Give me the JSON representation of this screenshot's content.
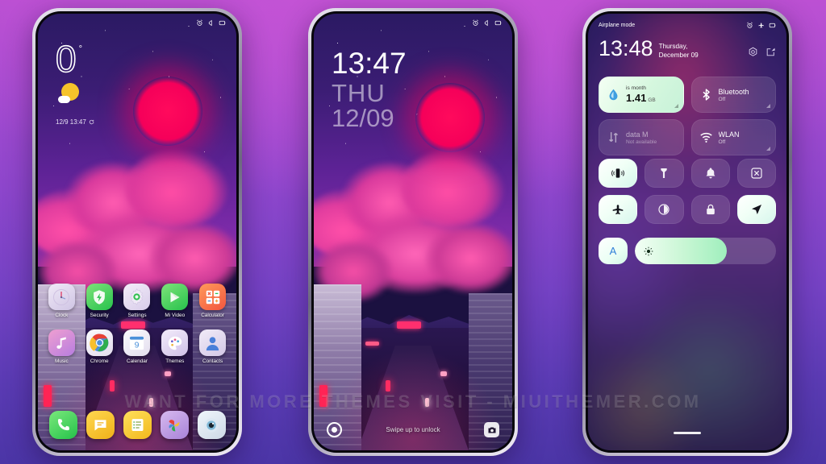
{
  "watermark": "WANT FOR MORE THEMES VISIT  -  MIUITHEMER.COM",
  "phone1": {
    "name": "home-screen",
    "status_bar": {
      "icons": [
        "alarm-icon",
        "silent-icon",
        "battery-icon"
      ]
    },
    "weather_widget": {
      "temperature": "0",
      "degree": "°",
      "icon": "sun-behind-cloud-icon",
      "updated": "12/9 13:47",
      "refresh_icon": "refresh-icon"
    },
    "apps_row1": [
      {
        "label": "Clock",
        "icon": "clock-icon"
      },
      {
        "label": "Security",
        "icon": "shield-icon"
      },
      {
        "label": "Settings",
        "icon": "gear-icon"
      },
      {
        "label": "Mi Video",
        "icon": "play-icon"
      },
      {
        "label": "Calculator",
        "icon": "calculator-icon"
      }
    ],
    "apps_row2": [
      {
        "label": "Music",
        "icon": "music-note-icon"
      },
      {
        "label": "Chrome",
        "icon": "chrome-icon"
      },
      {
        "label": "Calendar",
        "icon": "calendar-icon",
        "day": "9"
      },
      {
        "label": "Themes",
        "icon": "palette-icon"
      },
      {
        "label": "Contacts",
        "icon": "person-icon"
      }
    ],
    "dock": [
      {
        "label": "Phone",
        "icon": "phone-icon"
      },
      {
        "label": "Messages",
        "icon": "message-icon"
      },
      {
        "label": "Notes",
        "icon": "notes-icon"
      },
      {
        "label": "Gallery",
        "icon": "gallery-icon"
      },
      {
        "label": "Camera",
        "icon": "camera-icon"
      }
    ]
  },
  "phone2": {
    "name": "lock-screen",
    "status_bar": {
      "icons": [
        "alarm-icon",
        "silent-icon",
        "battery-icon"
      ]
    },
    "clock": {
      "time": "13:47",
      "weekday": "THU",
      "date": "12/09"
    },
    "bottom": {
      "left_icon": "flashlight-icon",
      "hint": "Swipe up to unlock",
      "right_icon": "camera-icon"
    }
  },
  "phone3": {
    "name": "control-center",
    "status_bar": {
      "carrier": "Airplane mode",
      "icons": [
        "alarm-icon",
        "airplane-icon",
        "battery-icon"
      ]
    },
    "header": {
      "time": "13:48",
      "date": "Thursday, December 09",
      "icons": [
        "settings-hex-icon",
        "edit-icon"
      ]
    },
    "tiles_row1": [
      {
        "name": "data-usage-tile",
        "icon": "water-drop-icon",
        "label": "is month",
        "value": "1.41",
        "unit": "GB",
        "state": "on"
      },
      {
        "name": "bluetooth-tile",
        "icon": "bluetooth-icon",
        "title": "Bluetooth",
        "subtitle": "Off",
        "state": "off"
      }
    ],
    "tiles_row2": [
      {
        "name": "mobile-data-tile",
        "icon": "data-arrows-icon",
        "title": "data      M",
        "subtitle": "Not available",
        "state": "disabled"
      },
      {
        "name": "wlan-tile",
        "icon": "wifi-icon",
        "title": "WLAN",
        "subtitle": "Off",
        "state": "off"
      }
    ],
    "toggles_row1": [
      {
        "name": "vibrate-toggle",
        "icon": "vibrate-icon",
        "active": true
      },
      {
        "name": "flashlight-toggle",
        "icon": "flashlight-icon",
        "active": false
      },
      {
        "name": "ringer-toggle",
        "icon": "bell-icon",
        "active": false
      },
      {
        "name": "screenshot-toggle",
        "icon": "screenshot-icon",
        "active": false
      }
    ],
    "toggles_row2": [
      {
        "name": "airplane-toggle",
        "icon": "airplane-icon",
        "active": true
      },
      {
        "name": "dark-mode-toggle",
        "icon": "contrast-icon",
        "active": false
      },
      {
        "name": "lock-toggle",
        "icon": "lock-icon",
        "active": false
      },
      {
        "name": "location-toggle",
        "icon": "location-arrow-icon",
        "active": true
      }
    ],
    "brightness": {
      "auto_label": "A",
      "icon": "sun-icon",
      "percent": 65
    },
    "drag_handle": "drag-handle"
  },
  "colors": {
    "background_top": "#b84fd2",
    "background_bottom": "#4b35a6",
    "sun_red": "#f5005a",
    "tile_on": "#d5f7de",
    "accent_blue": "#2f7fd8"
  }
}
